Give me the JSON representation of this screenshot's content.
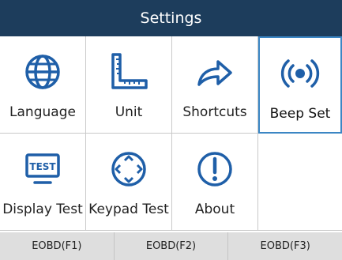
{
  "header": {
    "title": "Settings"
  },
  "menu": {
    "items": [
      {
        "label": "Language",
        "icon": "globe-icon"
      },
      {
        "label": "Unit",
        "icon": "ruler-icon"
      },
      {
        "label": "Shortcuts",
        "icon": "share-arrow-icon"
      },
      {
        "label": "Beep Set",
        "icon": "beep-icon",
        "selected": true
      },
      {
        "label": "Display Test",
        "icon": "display-test-icon"
      },
      {
        "label": "Keypad Test",
        "icon": "keypad-icon"
      },
      {
        "label": "About",
        "icon": "info-icon"
      }
    ]
  },
  "function_keys": [
    {
      "label": "EOBD(F1)"
    },
    {
      "label": "EOBD(F2)"
    },
    {
      "label": "EOBD(F3)"
    }
  ],
  "colors": {
    "title_bar": "#1d3d5c",
    "icon": "#1f5fa8",
    "selection_border": "#3b86c4",
    "function_bar": "#dedede"
  }
}
